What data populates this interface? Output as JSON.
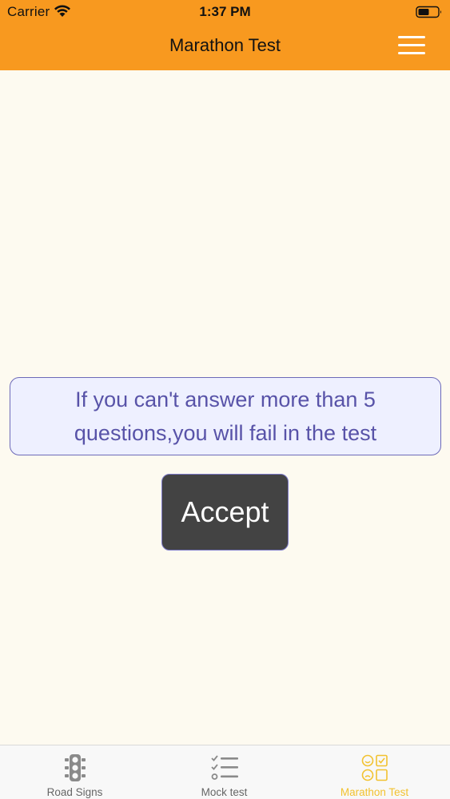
{
  "status_bar": {
    "carrier": "Carrier",
    "time": "1:37 PM",
    "icons": [
      "wifi-icon",
      "battery-icon"
    ]
  },
  "nav": {
    "title": "Marathon Test",
    "menu_icon": "hamburger-menu-icon"
  },
  "dialog": {
    "message": "If you can't answer more than 5 questions,you will fail in the test",
    "accept_label": "Accept"
  },
  "tabbar": {
    "tabs": [
      {
        "label": "Road Signs",
        "icon": "traffic-light-icon",
        "active": false
      },
      {
        "label": "Mock test",
        "icon": "checklist-icon",
        "active": false
      },
      {
        "label": "Marathon Test",
        "icon": "quiz-grid-icon",
        "active": true
      }
    ]
  },
  "colors": {
    "header_bg": "#f8991f",
    "page_bg": "#fdfaf0",
    "dialog_bg": "#eef0ff",
    "dialog_text": "#5853a8",
    "button_bg": "#434343",
    "tab_inactive": "#666666",
    "tab_active": "#f2c230"
  }
}
